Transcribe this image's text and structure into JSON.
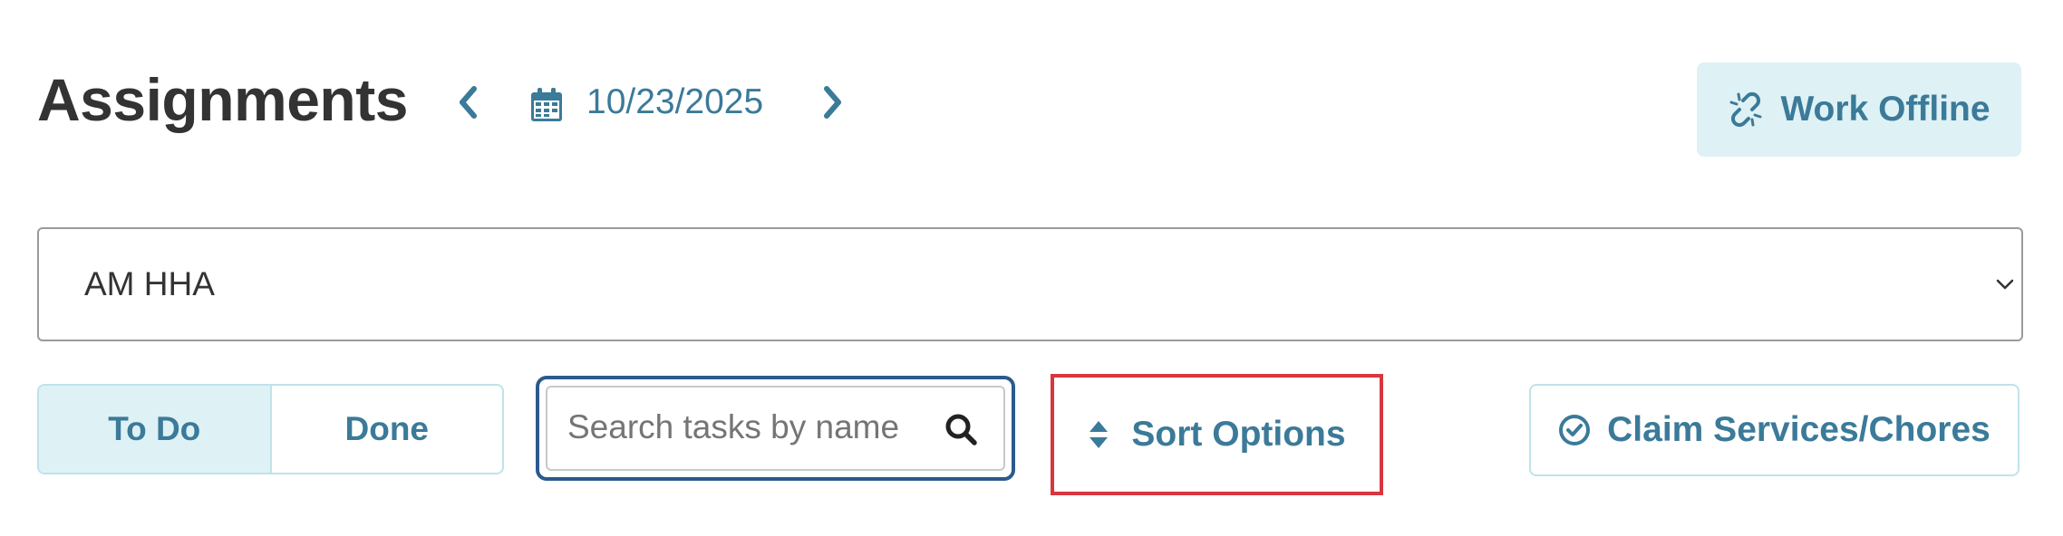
{
  "header": {
    "title": "Assignments",
    "date": "10/23/2025",
    "prev_icon": "chevron-left-icon",
    "next_icon": "chevron-right-icon",
    "calendar_icon": "calendar-icon"
  },
  "offline_button": {
    "label": "Work Offline",
    "icon": "broken-link-icon"
  },
  "schedule_select": {
    "value": "AM HHA"
  },
  "status_tabs": [
    {
      "label": "To Do",
      "active": true
    },
    {
      "label": "Done",
      "active": false
    }
  ],
  "search": {
    "placeholder": "Search tasks by name",
    "value": ""
  },
  "sort_button": {
    "label": "Sort Options",
    "icon": "sort-icon"
  },
  "claim_button": {
    "label": "Claim Services/Chores",
    "icon": "check-circle-icon"
  },
  "colors": {
    "accent": "#3b7a99",
    "accent_bg": "#def1f5",
    "highlight_border": "#d9363e",
    "focus_border": "#2b5a8c",
    "title": "#333333"
  }
}
